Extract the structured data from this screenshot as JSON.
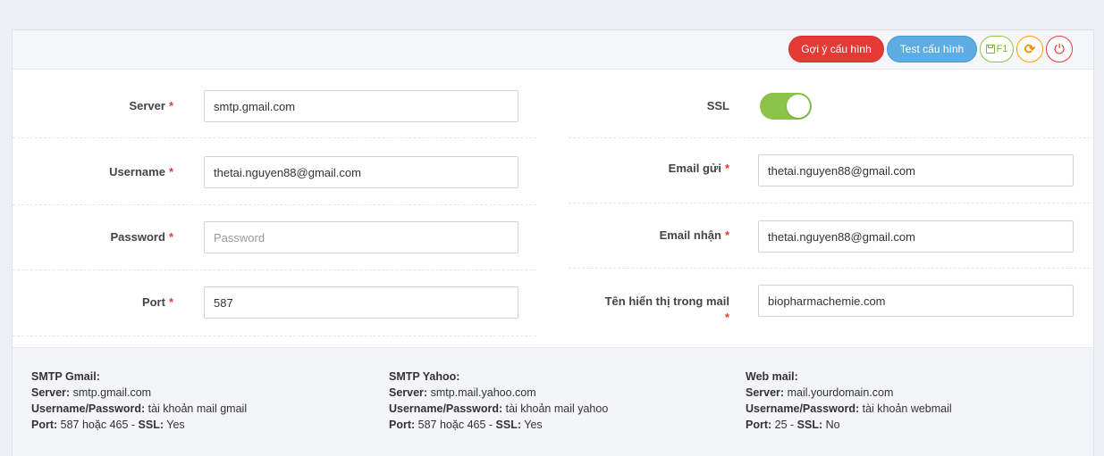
{
  "toolbar": {
    "suggest_label": "Gợi ý cấu hình",
    "test_label": "Test cấu hình",
    "save_label": "F1"
  },
  "form": {
    "server": {
      "label": "Server",
      "value": "smtp.gmail.com"
    },
    "username": {
      "label": "Username",
      "value": "thetai.nguyen88@gmail.com"
    },
    "password": {
      "label": "Password",
      "value": "",
      "placeholder": "Password"
    },
    "port": {
      "label": "Port",
      "value": "587"
    },
    "ssl": {
      "label": "SSL",
      "enabled": true
    },
    "email_from": {
      "label": "Email gửi",
      "value": "thetai.nguyen88@gmail.com"
    },
    "email_to": {
      "label": "Email nhận",
      "value": "thetai.nguyen88@gmail.com"
    },
    "display_name": {
      "label": "Tên hiển thị trong mail",
      "value": "biopharmachemie.com"
    },
    "required_mark": "*"
  },
  "info": {
    "gmail": {
      "title": "SMTP Gmail:",
      "server_key": "Server:",
      "server_val": "smtp.gmail.com",
      "cred_key": "Username/Password:",
      "cred_val": "tài khoản mail gmail",
      "port_key": "Port:",
      "port_val": "587 hoặc 465",
      "ssl_key": "SSL:",
      "ssl_val": "Yes"
    },
    "yahoo": {
      "title": "SMTP Yahoo:",
      "server_key": "Server:",
      "server_val": "smtp.mail.yahoo.com",
      "cred_key": "Username/Password:",
      "cred_val": "tài khoản mail yahoo",
      "port_key": "Port:",
      "port_val": "587 hoặc 465",
      "ssl_key": "SSL:",
      "ssl_val": "Yes"
    },
    "web": {
      "title": "Web mail:",
      "server_key": "Server:",
      "server_val": "mail.yourdomain.com",
      "cred_key": "Username/Password:",
      "cred_val": "tài khoản webmail",
      "port_key": "Port:",
      "port_val": "25",
      "ssl_key": "SSL:",
      "ssl_val": "No"
    }
  },
  "colors": {
    "danger": "#e53935",
    "info": "#5dade2",
    "success": "#8bc34a",
    "warning": "#ff9800"
  }
}
